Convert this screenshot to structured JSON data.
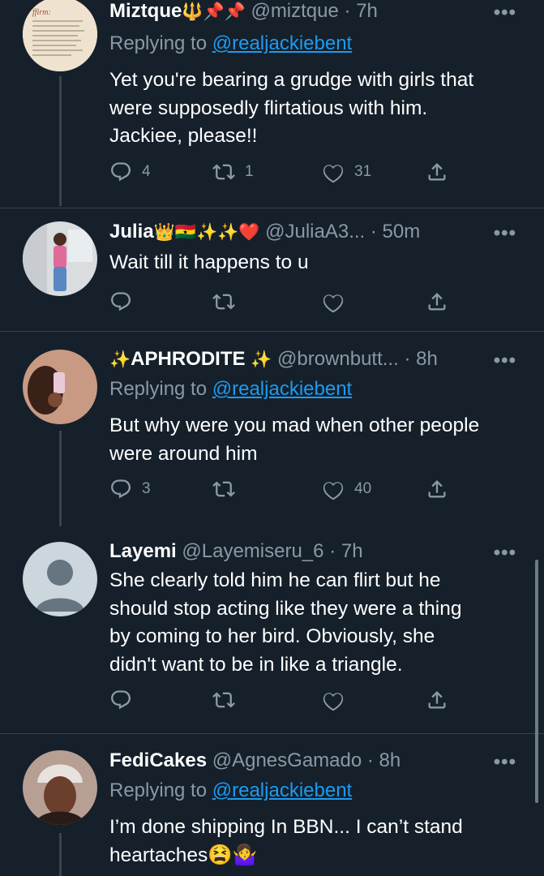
{
  "tweets": [
    {
      "name": "Miztque",
      "name_emoji": "🔱📌📌",
      "handle": "@miztque",
      "time": "· 7h",
      "replying_prefix": "Replying to ",
      "replying_to": "@realjackiebent",
      "lines": [
        "Yet you're bearing a grudge with girls that",
        "were supposedly flirtatious with him.",
        "Jackiee, please!!"
      ],
      "replies": "4",
      "retweets": "1",
      "likes": "31"
    },
    {
      "name": "Julia",
      "name_emoji": "👑🇬🇭✨✨❤️",
      "handle": "@JuliaA3...",
      "time": "· 50m",
      "lines": [
        "Wait till it happens to u"
      ],
      "replies": "",
      "retweets": "",
      "likes": ""
    },
    {
      "name_prefix_emoji": "✨",
      "name": "APHRODITE",
      "name_emoji": "✨",
      "handle": "@brownbutt...",
      "time": "· 8h",
      "replying_prefix": "Replying to ",
      "replying_to": "@realjackiebent",
      "lines": [
        "But why were you mad when other people",
        "were around him"
      ],
      "replies": "3",
      "retweets": "",
      "likes": "40"
    },
    {
      "name": "Layemi",
      "handle": "@Layemiseru_6",
      "time": "· 7h",
      "lines": [
        "She clearly told him he can flirt but he",
        "should stop acting like they were a thing",
        "by coming to her bird. Obviously, she",
        "didn't want to be in like a triangle."
      ],
      "replies": "",
      "retweets": "",
      "likes": ""
    },
    {
      "name": "FediCakes",
      "handle": "@AgnesGamado",
      "time": "· 8h",
      "replying_prefix": "Replying to ",
      "replying_to": "@realjackiebent",
      "lines": [
        "I’m done shipping In BBN... I can’t stand",
        "heartaches😫🤷‍♀️"
      ],
      "replies": "",
      "retweets": "",
      "likes": ""
    }
  ],
  "more_label": "•••",
  "icons": {
    "reply": "reply-icon",
    "retweet": "retweet-icon",
    "like": "like-icon",
    "share": "share-icon",
    "more": "more-icon"
  },
  "colors": {
    "background": "#15202b",
    "muted": "#8b98a5",
    "link": "#1d9bf0",
    "divider": "#38444d"
  }
}
